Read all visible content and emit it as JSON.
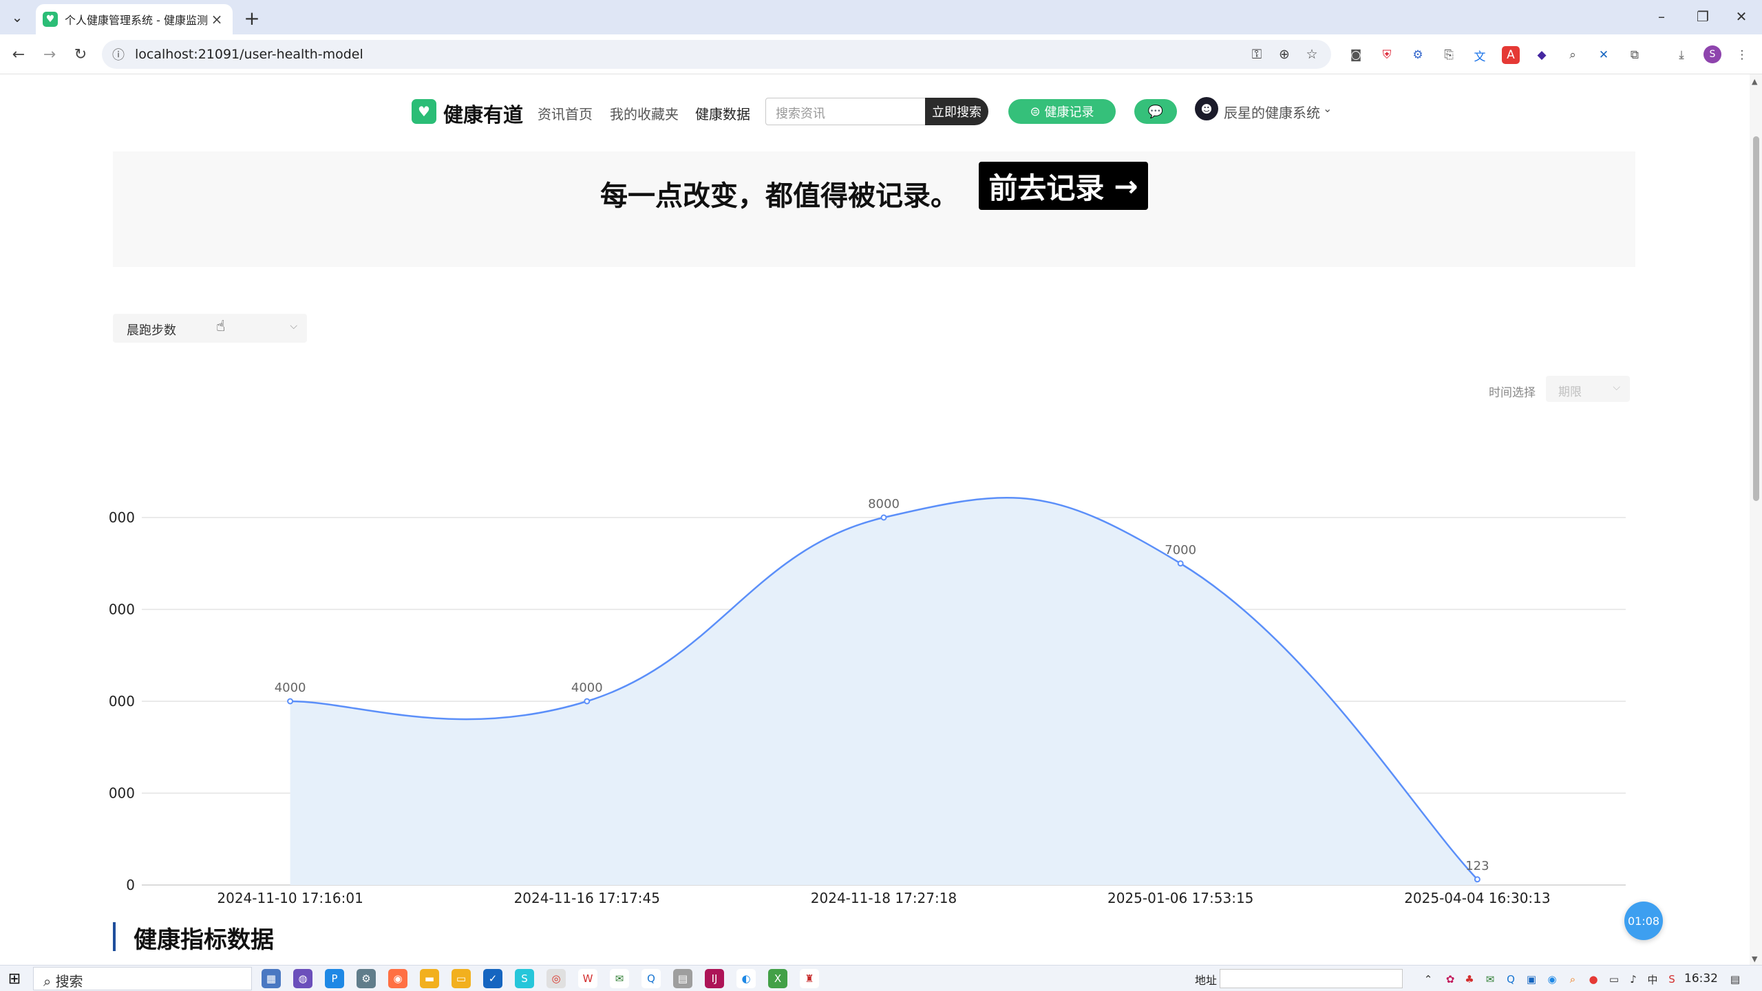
{
  "browser": {
    "tab_title": "个人健康管理系统 - 健康监测 |",
    "url": "localhost:21091/user-health-model",
    "profile_initial": "S"
  },
  "site": {
    "brand": "健康有道",
    "nav": [
      "资讯首页",
      "我的收藏夹",
      "健康数据"
    ],
    "search_placeholder": "搜索资讯",
    "search_button": "立即搜索",
    "record_button": "健康记录",
    "user_name": "辰星的健康系统"
  },
  "banner": {
    "text": "每一点改变，都值得被记录。",
    "button": "前去记录"
  },
  "metric_select": {
    "value": "晨跑步数"
  },
  "time_filter": {
    "label": "时间选择",
    "placeholder": "期限"
  },
  "chart_data": {
    "type": "area",
    "title": "",
    "xlabel": "",
    "ylabel": "",
    "categories": [
      "2024-11-10 17:16:01",
      "2024-11-16 17:17:45",
      "2024-11-18 17:27:18",
      "2025-01-06 17:53:15",
      "2025-04-04 16:30:13"
    ],
    "values": [
      4000,
      4000,
      8000,
      7000,
      123
    ],
    "data_labels": [
      "4000",
      "4000",
      "8000",
      "7000",
      "123"
    ],
    "ylim": [
      0,
      8000
    ],
    "yticks": [
      0,
      2000,
      4000,
      6000,
      8000
    ],
    "ytick_labels": [
      "0",
      "000",
      "000",
      "000",
      "000"
    ],
    "smooth": true,
    "grid": true,
    "line_color": "#5b8ff9",
    "fill_color": "#e6f0fa"
  },
  "section": {
    "title": "健康指标数据"
  },
  "floating_timer": "01:08",
  "taskbar": {
    "search": "搜索",
    "address_label": "地址",
    "clock": "16:32"
  }
}
